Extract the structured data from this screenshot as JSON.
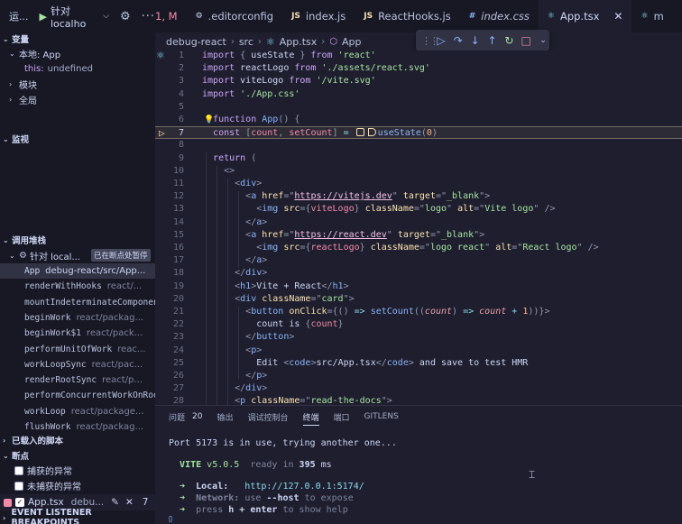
{
  "sidebar": {
    "run_label": "运...",
    "config_name": "针对 localho",
    "sections": {
      "variables": "变量",
      "watch": "监视",
      "callstack": "调用堆栈",
      "loaded_scripts": "已载入的脚本",
      "breakpoints": "断点",
      "event_listener": "EVENT LISTENER BREAKPOINTS"
    },
    "variables": {
      "local_scope": "本地: App",
      "this_key": "this:",
      "this_value": "undefined",
      "block_scope": "模块",
      "global_scope": "全局"
    },
    "callstack": {
      "session": "针对 local...",
      "paused_badge": "已在断点处暂停",
      "frames": [
        {
          "fn": "App",
          "src": "debug-react/src/App..."
        },
        {
          "fn": "renderWithHooks",
          "src": "react/..."
        },
        {
          "fn": "mountIndeterminateComponent",
          "src": ""
        },
        {
          "fn": "beginWork",
          "src": "react/packag..."
        },
        {
          "fn": "beginWork$1",
          "src": "react/pack..."
        },
        {
          "fn": "performUnitOfWork",
          "src": "reac..."
        },
        {
          "fn": "workLoopSync",
          "src": "react/pac..."
        },
        {
          "fn": "renderRootSync",
          "src": "react/p..."
        },
        {
          "fn": "performConcurrentWorkOnRoot",
          "src": ""
        },
        {
          "fn": "workLoop",
          "src": "react/package..."
        },
        {
          "fn": "flushWork",
          "src": "react/packag..."
        }
      ]
    },
    "exceptions": {
      "caught": "捕获的异常",
      "uncaught": "未捕获的异常"
    },
    "breakpoint_item": {
      "file": "App.tsx",
      "path": "debu...",
      "count": "7"
    }
  },
  "tabs": [
    {
      "label": "1, M",
      "icon": "",
      "color": "#f38ba8"
    },
    {
      "label": ".editorconfig",
      "icon": "gear-icon",
      "color": "#cdd6f4"
    },
    {
      "label": "index.js",
      "icon": "js-icon",
      "color": "#f9e2af"
    },
    {
      "label": "ReactHooks.js",
      "icon": "js-icon",
      "color": "#f9e2af"
    },
    {
      "label": "index.css",
      "icon": "css-icon",
      "color": "#89b4fa"
    },
    {
      "label": "App.tsx",
      "icon": "react-icon",
      "color": "#89dceb"
    },
    {
      "label": "m",
      "icon": "react-icon",
      "color": "#89dceb"
    }
  ],
  "breadcrumb": [
    "debug-react",
    "src",
    "App.tsx",
    "App"
  ],
  "editor": {
    "line_numbers": [
      "1",
      "2",
      "3",
      "4",
      "5",
      "6",
      "7",
      "8",
      "9",
      "10",
      "11",
      "12",
      "13",
      "14",
      "15",
      "16",
      "17",
      "18",
      "19",
      "20",
      "21",
      "22",
      "23",
      "24",
      "25",
      "26",
      "27",
      "28"
    ]
  },
  "panel": {
    "tabs": [
      {
        "label": "问题",
        "count": "20"
      },
      {
        "label": "输出",
        "count": ""
      },
      {
        "label": "调试控制台",
        "count": ""
      },
      {
        "label": "终端",
        "count": ""
      },
      {
        "label": "端口",
        "count": ""
      },
      {
        "label": "GITLENS",
        "count": ""
      }
    ],
    "terminal": {
      "port_msg": "Port 5173 is in use, trying another one...",
      "vite_name": "VITE",
      "vite_version": "v5.0.5",
      "ready_text": "ready in",
      "ready_ms": "395",
      "ms_unit": "ms",
      "local_label": "Local:",
      "local_url": "http://127.0.0.1:5174/",
      "network_label": "Network:",
      "network_text": "use",
      "host_flag": "--host",
      "network_suffix": "to expose",
      "help_prefix": "press",
      "help_key": "h + enter",
      "help_suffix": "to show help"
    }
  },
  "colors": {
    "background": "#1e1e2e",
    "sidebar": "#181825",
    "accent": "#89b4fa",
    "keyword": "#cba6f7",
    "string": "#a6e3a1",
    "breakpoint": "#f9e2af"
  }
}
